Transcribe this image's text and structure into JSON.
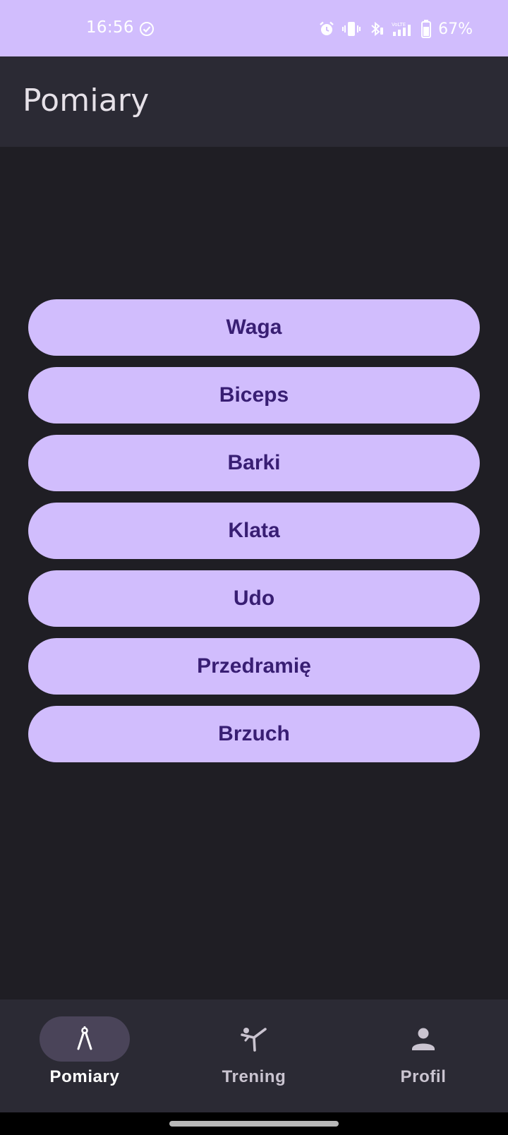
{
  "status_bar": {
    "time": "16:56",
    "battery": "67%",
    "icons": [
      "check-circle-icon",
      "alarm-icon",
      "vibrate-icon",
      "bluetooth-icon",
      "signal-icon",
      "battery-icon"
    ],
    "background": "#d1bdfd"
  },
  "app_bar": {
    "title": "Pomiary"
  },
  "measurements": [
    {
      "label": "Waga"
    },
    {
      "label": "Biceps"
    },
    {
      "label": "Barki"
    },
    {
      "label": "Klata"
    },
    {
      "label": "Udo"
    },
    {
      "label": "Przedramię"
    },
    {
      "label": "Brzuch"
    }
  ],
  "bottom_nav": {
    "items": [
      {
        "label": "Pomiary",
        "icon": "compass-drafting-icon",
        "active": true
      },
      {
        "label": "Trening",
        "icon": "martial-arts-kick-icon",
        "active": false
      },
      {
        "label": "Profil",
        "icon": "person-icon",
        "active": false
      }
    ]
  },
  "colors": {
    "accent": "#d1bdfd",
    "on_accent": "#381e73",
    "background": "#1f1e24",
    "surface": "#2b2a34",
    "nav_indicator": "#4a4459"
  }
}
